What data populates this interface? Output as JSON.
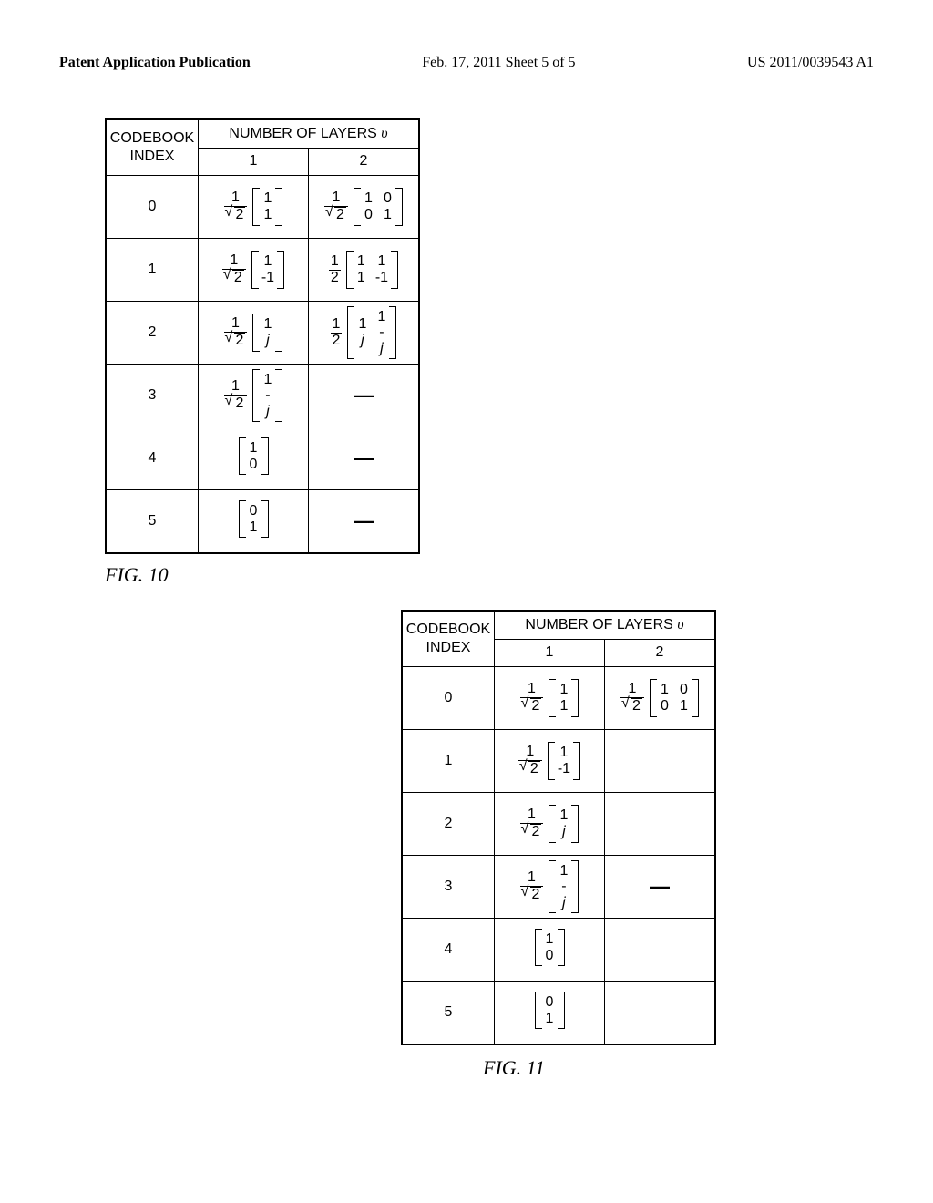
{
  "header": {
    "left": "Patent Application Publication",
    "center": "Feb. 17, 2011  Sheet 5 of 5",
    "right": "US 2011/0039543 A1"
  },
  "labels": {
    "codebook_index": "CODEBOOK INDEX",
    "num_layers_prefix": "NUMBER OF LAYERS ",
    "num_layers_var": "υ",
    "layer1": "1",
    "layer2": "2"
  },
  "fig10": {
    "caption": "FIG. 10",
    "rows": [
      {
        "index": "0",
        "l1": {
          "type": "frac_sqrt_mat",
          "frac_num": "1",
          "frac_den_rad": "2",
          "cols": [
            [
              "1",
              "1"
            ]
          ]
        },
        "l2": {
          "type": "frac_sqrt_mat",
          "frac_num": "1",
          "frac_den_rad": "2",
          "cols": [
            [
              "1",
              "0"
            ],
            [
              "0",
              "1"
            ]
          ]
        }
      },
      {
        "index": "1",
        "l1": {
          "type": "frac_sqrt_mat",
          "frac_num": "1",
          "frac_den_rad": "2",
          "cols": [
            [
              "1",
              "-1"
            ]
          ]
        },
        "l2": {
          "type": "frac_plain_mat",
          "frac_num": "1",
          "frac_den": "2",
          "cols": [
            [
              "1",
              "1"
            ],
            [
              "1",
              "-1"
            ]
          ]
        }
      },
      {
        "index": "2",
        "l1": {
          "type": "frac_sqrt_mat",
          "frac_num": "1",
          "frac_den_rad": "2",
          "cols": [
            [
              "1",
              "j"
            ]
          ]
        },
        "l2": {
          "type": "frac_plain_mat",
          "frac_num": "1",
          "frac_den": "2",
          "cols": [
            [
              "1",
              "j"
            ],
            [
              "1",
              "-j"
            ]
          ]
        }
      },
      {
        "index": "3",
        "l1": {
          "type": "frac_sqrt_mat",
          "frac_num": "1",
          "frac_den_rad": "2",
          "cols": [
            [
              "1",
              "-j"
            ]
          ]
        },
        "l2": {
          "type": "dash"
        }
      },
      {
        "index": "4",
        "l1": {
          "type": "mat",
          "cols": [
            [
              "1",
              "0"
            ]
          ]
        },
        "l2": {
          "type": "dash"
        }
      },
      {
        "index": "5",
        "l1": {
          "type": "mat",
          "cols": [
            [
              "0",
              "1"
            ]
          ]
        },
        "l2": {
          "type": "dash"
        }
      }
    ]
  },
  "fig11": {
    "caption": "FIG. 11",
    "rows": [
      {
        "index": "0",
        "l1": {
          "type": "frac_sqrt_mat",
          "frac_num": "1",
          "frac_den_rad": "2",
          "cols": [
            [
              "1",
              "1"
            ]
          ]
        },
        "l2": {
          "type": "frac_sqrt_mat",
          "frac_num": "1",
          "frac_den_rad": "2",
          "cols": [
            [
              "1",
              "0"
            ],
            [
              "0",
              "1"
            ]
          ]
        }
      },
      {
        "index": "1",
        "l1": {
          "type": "frac_sqrt_mat",
          "frac_num": "1",
          "frac_den_rad": "2",
          "cols": [
            [
              "1",
              "-1"
            ]
          ]
        },
        "l2": {
          "type": "empty"
        }
      },
      {
        "index": "2",
        "l1": {
          "type": "frac_sqrt_mat",
          "frac_num": "1",
          "frac_den_rad": "2",
          "cols": [
            [
              "1",
              "j"
            ]
          ]
        },
        "l2": {
          "type": "empty"
        }
      },
      {
        "index": "3",
        "l1": {
          "type": "frac_sqrt_mat",
          "frac_num": "1",
          "frac_den_rad": "2",
          "cols": [
            [
              "1",
              "-j"
            ]
          ]
        },
        "l2": {
          "type": "dash"
        }
      },
      {
        "index": "4",
        "l1": {
          "type": "mat",
          "cols": [
            [
              "1",
              "0"
            ]
          ]
        },
        "l2": {
          "type": "empty"
        }
      },
      {
        "index": "5",
        "l1": {
          "type": "mat",
          "cols": [
            [
              "0",
              "1"
            ]
          ]
        },
        "l2": {
          "type": "empty"
        }
      }
    ]
  }
}
